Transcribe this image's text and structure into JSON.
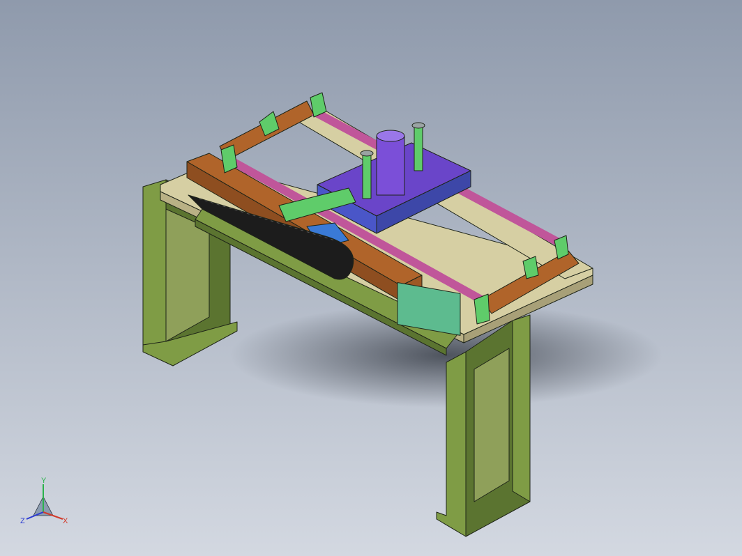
{
  "viewport": {
    "bg_top": "#8f9aac",
    "bg_bottom": "#d3d8e1"
  },
  "colors": {
    "frame_green": "#7f9c45",
    "frame_green_dark": "#5b7430",
    "plate_tan": "#d6cfa3",
    "rail_orange": "#b0642a",
    "rod_magenta": "#c0569a",
    "carriage_purple": "#6a45c9",
    "carriage_blue": "#4a56c8",
    "bracket_green": "#5fcc6a",
    "cylinder_purple": "#7b4fd8",
    "drag_chain_black": "#1c1c1c",
    "slide_teal": "#5dbb8f"
  },
  "triad": {
    "y_label": "Y",
    "x_label": "X",
    "z_label": "Z",
    "y_color": "#2bb24c",
    "x_color": "#d23a2a",
    "z_color": "#2a3ad2"
  }
}
